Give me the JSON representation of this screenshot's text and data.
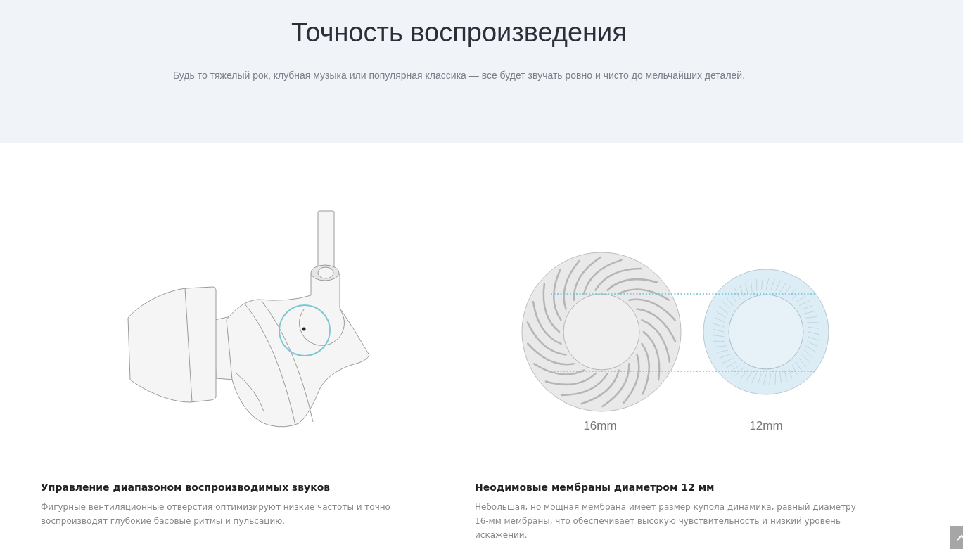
{
  "header": {
    "title": "Точность воспроизведения",
    "subtitle": "Будь то тяжелый рок, клубная музыка или популярная классика — все будет звучать ровно и чисто до мельчайших деталей."
  },
  "features": [
    {
      "kind": "earphone",
      "title": "Управление диапазоном воспроизводимых звуков",
      "text": "Фигурные вентиляционные отверстия оптимизируют низкие частоты и точно воспроизводят глубокие басовые ритмы и пульсацию."
    },
    {
      "kind": "membranes",
      "labels": [
        "16mm",
        "12mm"
      ],
      "title": "Неодимовые мембраны диаметром 12 мм",
      "text": "Небольшая, но мощная мембрана имеет размер купола динамика, равный диаметру 16-мм мембраны, что обеспечивает высокую чувствительность и низкий уровень искажений."
    }
  ]
}
